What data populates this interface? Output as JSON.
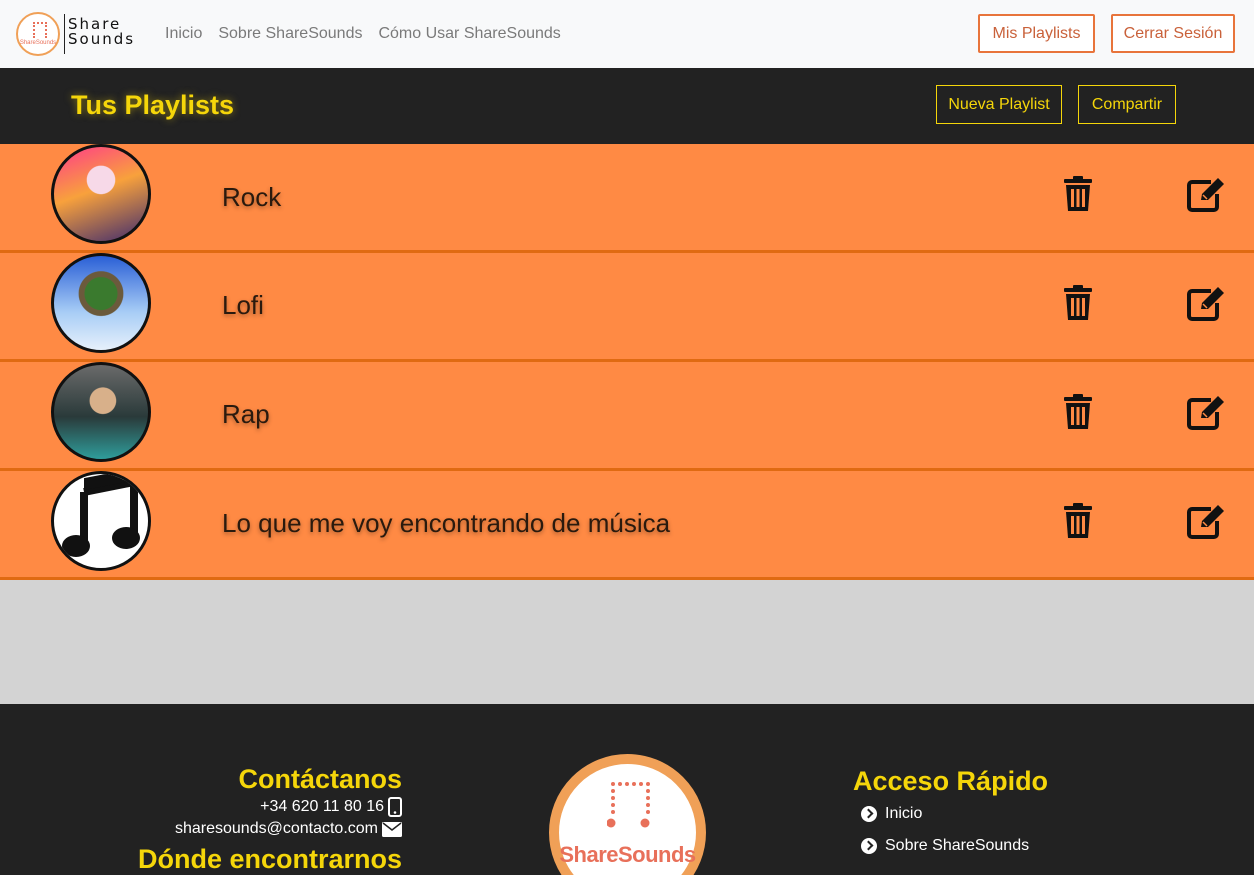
{
  "nav": {
    "brand_line1": "Share",
    "brand_line2": "Sounds",
    "brand_mini": "ShareSounds",
    "links": [
      "Inicio",
      "Sobre ShareSounds",
      "Cómo Usar ShareSounds"
    ],
    "btn_playlists": "Mis Playlists",
    "btn_logout": "Cerrar Sesión"
  },
  "header": {
    "title": "Tus Playlists",
    "btn_new": "Nueva Playlist",
    "btn_share": "Compartir"
  },
  "playlists": [
    {
      "name": "Rock",
      "cover": "album-cover-image"
    },
    {
      "name": "Lofi",
      "cover": "album-cover-image"
    },
    {
      "name": "Rap",
      "cover": "album-cover-image"
    },
    {
      "name": "Lo que me voy encontrando de música",
      "cover": "music-note-icon"
    }
  ],
  "footer": {
    "contact_title": "Contáctanos",
    "phone": "+34 620 11 80 16",
    "email": "sharesounds@contacto.com",
    "find_title": "Dónde encontrarnos",
    "logo_text": "ShareSounds",
    "quick_title": "Acceso Rápido",
    "quick_links": [
      "Inicio",
      "Sobre ShareSounds"
    ]
  },
  "colors": {
    "accent_orange": "#ff8a44",
    "accent_yellow": "#f5d60a",
    "dark": "#222222",
    "nav_button_border": "#e8743b"
  }
}
